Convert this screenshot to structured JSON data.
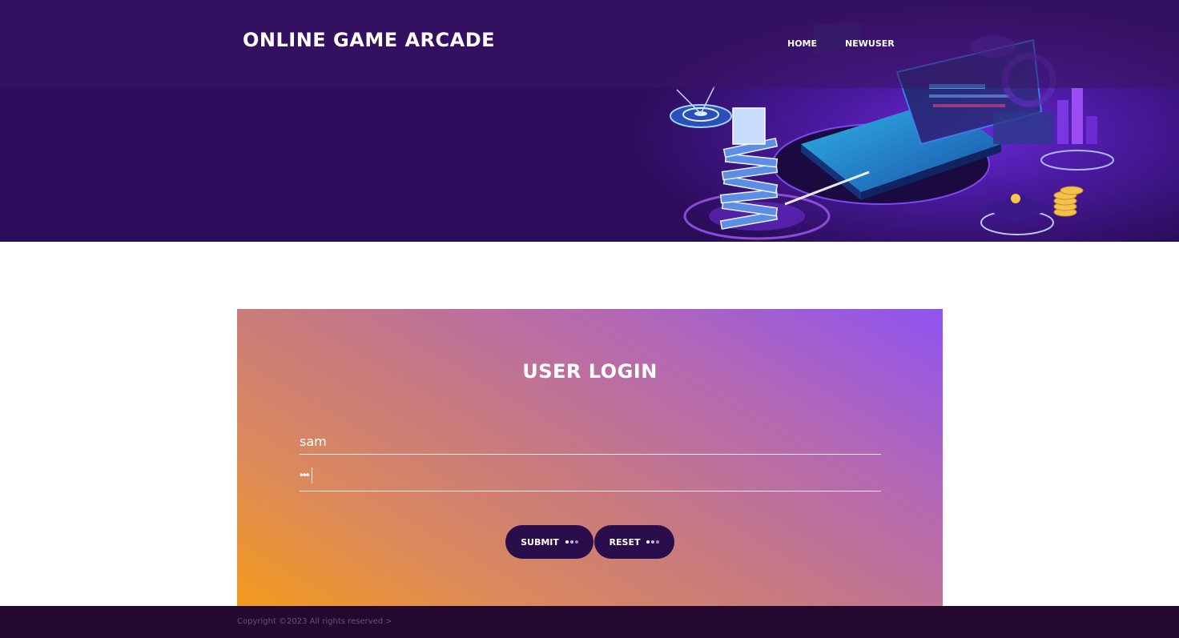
{
  "header": {
    "brand": "ONLINE GAME ARCADE",
    "nav": [
      "HOME",
      "NEWUSER"
    ],
    "illustration": "laptop-books-graduation-cap-illustration"
  },
  "login": {
    "title": "USER LOGIN",
    "username_value": "sam",
    "password_mask": "•••",
    "submit_label": "SUBMIT",
    "reset_label": "RESET"
  },
  "footer": {
    "copyright": "Copyright ©2023 All rights reserved >"
  },
  "colors": {
    "header_bg": "#2c0d5c",
    "button_bg": "#2a0d4b",
    "footer_bg": "#24082f",
    "gradient_start": "#f39a1c",
    "gradient_end": "#8f53f2"
  }
}
